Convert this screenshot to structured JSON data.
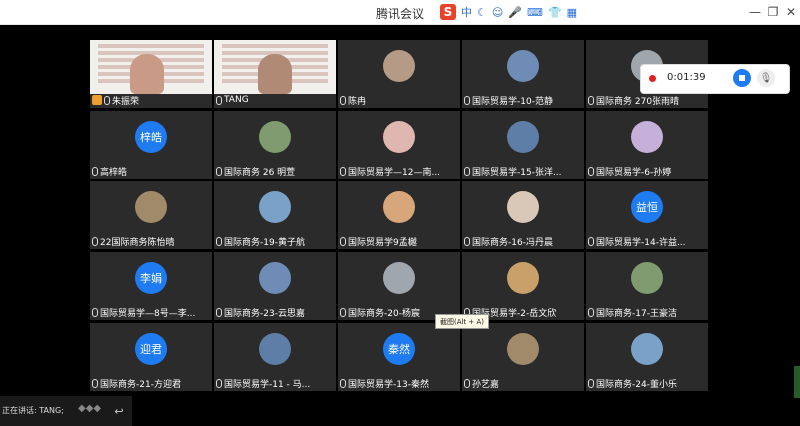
{
  "window": {
    "title": "腾讯会议"
  },
  "ime": {
    "lang": "中",
    "icons": [
      "moon-icon",
      "emoji-icon",
      "mic-icon",
      "keyboard-icon",
      "shirt-icon",
      "grid-icon"
    ]
  },
  "recording": {
    "time": "0:01:39"
  },
  "participants": [
    {
      "name": "朱振荣",
      "kind": "video"
    },
    {
      "name": "TANG",
      "kind": "video"
    },
    {
      "name": "陈冉",
      "kind": "photo"
    },
    {
      "name": "国际贸易学-10-范静",
      "kind": "photo"
    },
    {
      "name": "国际商务 270张雨晴",
      "kind": "photo"
    },
    {
      "name": "高梓皓",
      "kind": "initials",
      "initials": "梓皓"
    },
    {
      "name": "国际商务 26 明萱",
      "kind": "photo"
    },
    {
      "name": "国际贸易学—12—南...",
      "kind": "photo"
    },
    {
      "name": "国际贸易学-15-张洋...",
      "kind": "photo"
    },
    {
      "name": "国际贸易学-6-孙婷",
      "kind": "photo"
    },
    {
      "name": "22国际商务陈怡晴",
      "kind": "photo"
    },
    {
      "name": "国际商务-19-黄子航",
      "kind": "photo"
    },
    {
      "name": "国际贸易学9孟樾",
      "kind": "photo"
    },
    {
      "name": "国际商务-16-冯丹晨",
      "kind": "photo"
    },
    {
      "name": "国际贸易学-14-许益...",
      "kind": "initials",
      "initials": "益恒"
    },
    {
      "name": "国际贸易学—8号—李...",
      "kind": "initials",
      "initials": "李娟"
    },
    {
      "name": "国际商务-23-云思嘉",
      "kind": "photo"
    },
    {
      "name": "国际商务-20-杨宸",
      "kind": "photo"
    },
    {
      "name": "国际贸易学-2-岳文欣",
      "kind": "photo"
    },
    {
      "name": "国际商务-17-王豪洁",
      "kind": "photo"
    },
    {
      "name": "国际商务-21-方迎君",
      "kind": "initials",
      "initials": "迎君"
    },
    {
      "name": "国际贸易学-11 - 马...",
      "kind": "photo"
    },
    {
      "name": "国际贸易学-13-秦然",
      "kind": "initials",
      "initials": "秦然"
    },
    {
      "name": "孙艺嘉",
      "kind": "photo"
    },
    {
      "name": "国际商务-24-董小乐",
      "kind": "photo"
    }
  ],
  "tooltip": "截图(Alt + A)",
  "bottom": {
    "speaking": "正在讲话: TANG;"
  }
}
